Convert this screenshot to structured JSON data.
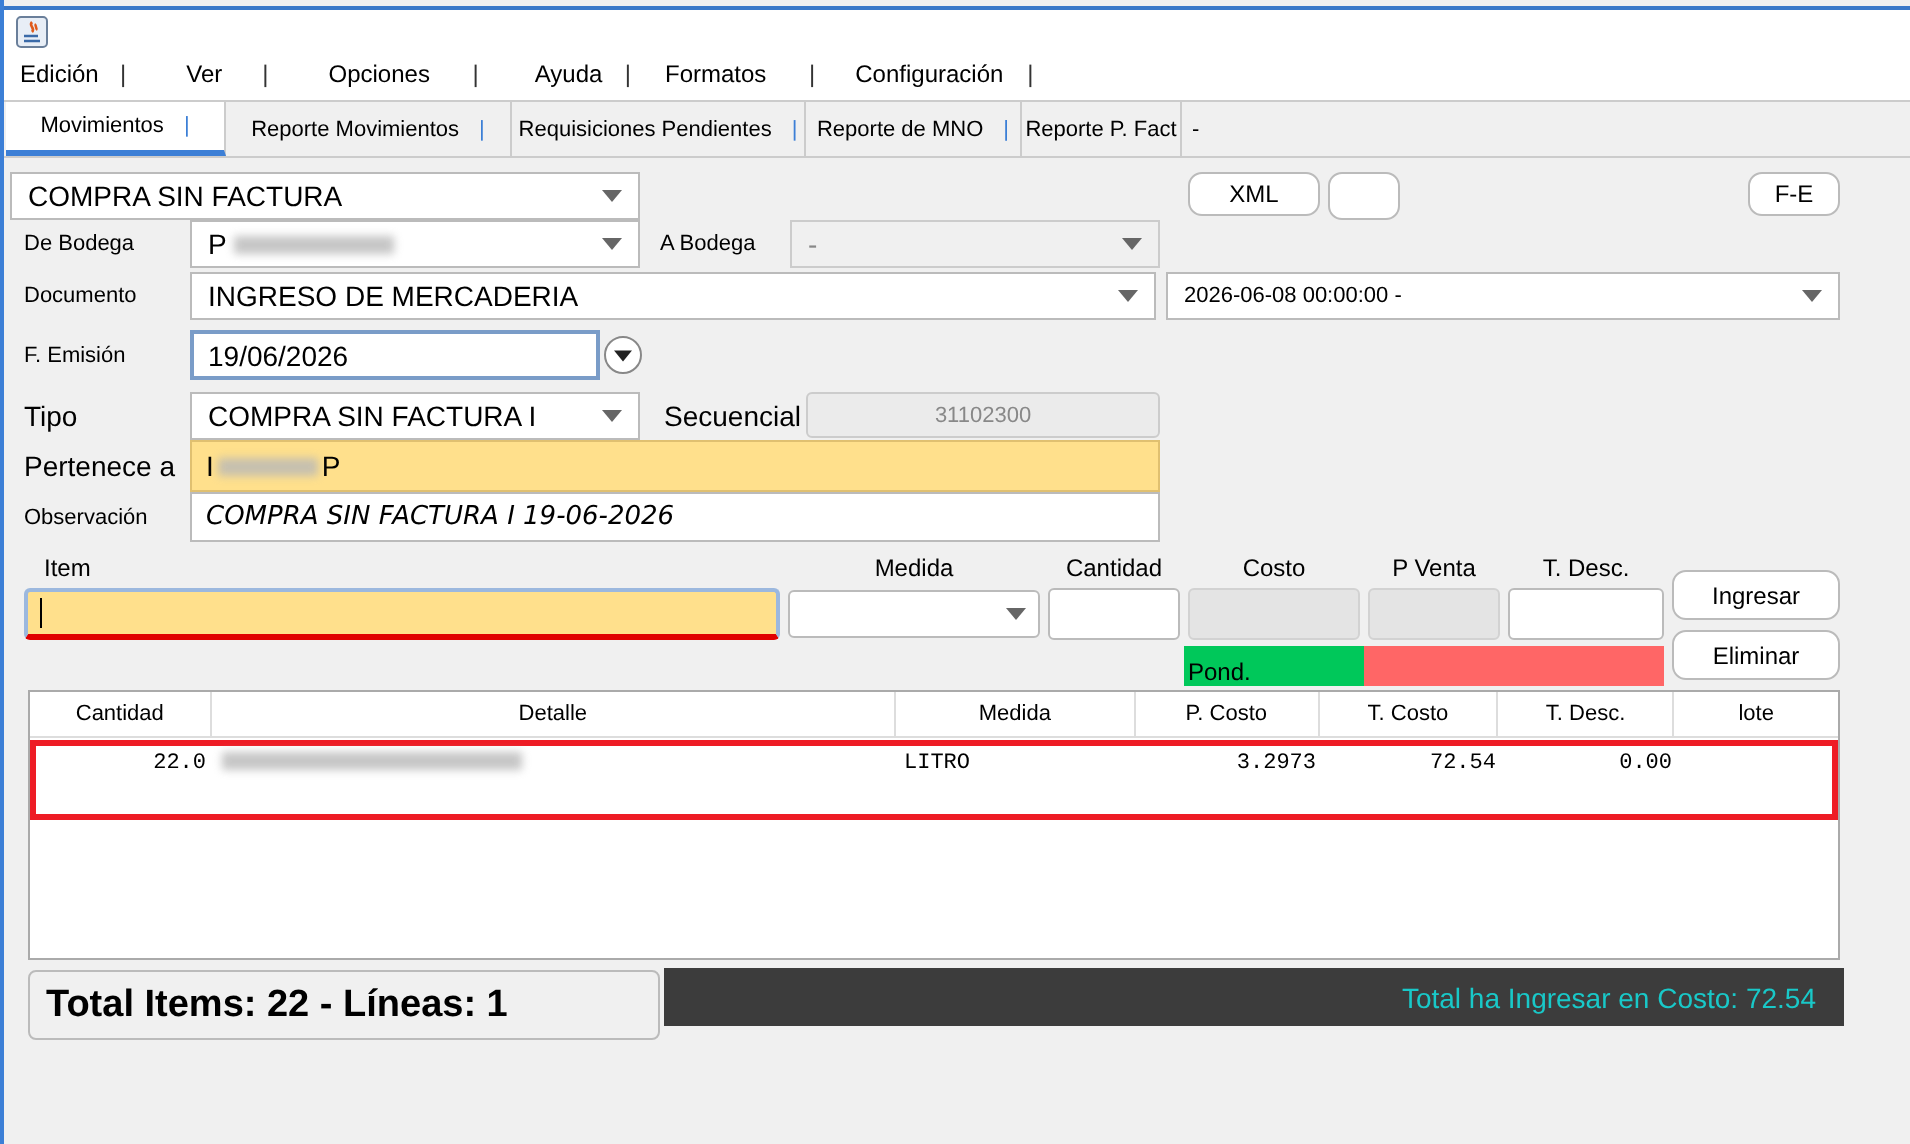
{
  "menu": [
    {
      "label": "Edición",
      "separator": "|"
    },
    {
      "label": "Ver",
      "separator": "|"
    },
    {
      "label": "Opciones",
      "separator": "|"
    },
    {
      "label": "Ayuda",
      "separator": "|"
    },
    {
      "label": "Formatos",
      "separator": "|"
    },
    {
      "label": "Configuración",
      "separator": "|"
    }
  ],
  "tabs": [
    {
      "label": "Movimientos",
      "separator": "|",
      "selected": true
    },
    {
      "label": "Reporte Movimientos",
      "separator": "|",
      "selected": false
    },
    {
      "label": "Requisiciones Pendientes",
      "separator": "|",
      "selected": false
    },
    {
      "label": "Reporte de MNO",
      "separator": "|",
      "selected": false
    },
    {
      "label": "Reporte P. Fact",
      "selected": false
    },
    {
      "label": "-",
      "selected": false
    }
  ],
  "movement_type": {
    "value": "COMPRA SIN FACTURA"
  },
  "xml_button": {
    "label": "XML"
  },
  "fe_button": {
    "label": "F-E"
  },
  "de_bodega": {
    "label": "De Bodega",
    "value": "P",
    "redacted": true
  },
  "a_bodega": {
    "label": "A Bodega",
    "value": "-",
    "disabled": true
  },
  "documento": {
    "label": "Documento",
    "value": "INGRESO DE MERCADERIA"
  },
  "fecha_documento": {
    "value": "2026-06-08 00:00:00 -"
  },
  "f_emision": {
    "label": "F. Emisión",
    "value": "19/06/2026"
  },
  "tipo": {
    "label": "Tipo",
    "value": "COMPRA SIN FACTURA I"
  },
  "secuencial": {
    "label": "Secuencial",
    "value": "31102300",
    "disabled": true
  },
  "pertenece_a": {
    "label": "Pertenece a",
    "value": "I",
    "value_end": "P",
    "redacted": true
  },
  "observacion": {
    "label": "Observación",
    "value": "COMPRA SIN FACTURA I 19-06-2026"
  },
  "entry_fields": [
    {
      "kind": "text",
      "label": "Item",
      "focused": true,
      "disabled": false
    },
    {
      "kind": "combo",
      "label": "Medida",
      "focused": false,
      "disabled": false
    },
    {
      "kind": "text",
      "label": "Cantidad",
      "focused": false,
      "disabled": false
    },
    {
      "kind": "text",
      "label": "Costo",
      "focused": false,
      "disabled": true
    },
    {
      "kind": "text",
      "label": "P Venta",
      "focused": false,
      "disabled": true
    },
    {
      "kind": "text",
      "label": "T. Desc.",
      "focused": false,
      "disabled": false
    }
  ],
  "pond": {
    "label": "Pond."
  },
  "entry_buttons": [
    {
      "label": "Ingresar"
    },
    {
      "label": "Eliminar"
    }
  ],
  "table": {
    "columns": [
      "Cantidad",
      "Detalle",
      "Medida",
      "P. Costo",
      "T. Costo",
      "T. Desc.",
      "lote"
    ],
    "rows": [
      {
        "highlighted": true,
        "cantidad": "22.0",
        "detalle_redacted": true,
        "medida": "LITRO",
        "p_costo": "3.2973",
        "t_costo": "72.54",
        "t_desc": "0.00"
      }
    ]
  },
  "summary": {
    "totals": "Total Items: 22 - Líneas: 1",
    "cost_total": "Total ha Ingresar en Costo: 72.54"
  }
}
